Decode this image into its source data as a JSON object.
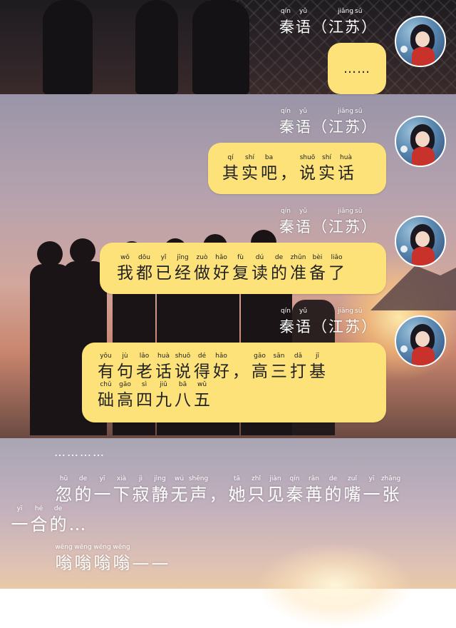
{
  "speaker_label": "秦语（江苏）",
  "speaker_pinyin": [
    "qín",
    "yǔ",
    "jiāng",
    "sū"
  ],
  "messages": [
    {
      "id": "m1",
      "text": "……",
      "lines": []
    },
    {
      "id": "m2",
      "lines": [
        [
          [
            "其",
            "qí"
          ],
          [
            "实",
            "shí"
          ],
          [
            "吧",
            "ba"
          ],
          [
            "，",
            ""
          ],
          [
            "说",
            "shuō"
          ],
          [
            "实",
            "shí"
          ],
          [
            "话",
            "huà"
          ]
        ]
      ]
    },
    {
      "id": "m3",
      "lines": [
        [
          [
            "我",
            "wǒ"
          ],
          [
            "都",
            "dōu"
          ],
          [
            "已",
            "yǐ"
          ],
          [
            "经",
            "jīng"
          ],
          [
            "做",
            "zuò"
          ],
          [
            "好",
            "hǎo"
          ],
          [
            "复",
            "fù"
          ],
          [
            "读",
            "dú"
          ],
          [
            "的",
            "de"
          ],
          [
            "准",
            "zhǔn"
          ],
          [
            "备",
            "bèi"
          ],
          [
            "了",
            "liǎo"
          ]
        ]
      ]
    },
    {
      "id": "m4",
      "lines": [
        [
          [
            "有",
            "yǒu"
          ],
          [
            "句",
            "jù"
          ],
          [
            "老",
            "lǎo"
          ],
          [
            "话",
            "huà"
          ],
          [
            "说",
            "shuō"
          ],
          [
            "得",
            "dé"
          ],
          [
            "好",
            "hǎo"
          ],
          [
            "，",
            ""
          ],
          [
            "高",
            "gāo"
          ],
          [
            "三",
            "sān"
          ],
          [
            "打",
            "dǎ"
          ],
          [
            "基",
            "jī"
          ]
        ],
        [
          [
            "础",
            "chǔ"
          ],
          [
            "高",
            "gāo"
          ],
          [
            "四",
            "sì"
          ],
          [
            "九",
            "jiǔ"
          ],
          [
            "八",
            "bā"
          ],
          [
            "五",
            "wǔ"
          ]
        ]
      ]
    }
  ],
  "narration": {
    "dots": "…………",
    "line1": [
      [
        "忽",
        "hū"
      ],
      [
        "的",
        "de"
      ],
      [
        "一",
        "yī"
      ],
      [
        "下",
        "xià"
      ],
      [
        "寂",
        "jì"
      ],
      [
        "静",
        "jìng"
      ],
      [
        "无",
        "wú"
      ],
      [
        "声",
        "shēng"
      ],
      [
        "，",
        ""
      ],
      [
        "她",
        "tā"
      ],
      [
        "只",
        "zhǐ"
      ],
      [
        "见",
        "jiàn"
      ],
      [
        "秦",
        "qín"
      ],
      [
        "苒",
        "rǎn"
      ],
      [
        "的",
        "de"
      ],
      [
        "嘴",
        "zuǐ"
      ],
      [
        "一",
        "yī"
      ],
      [
        "张",
        "zhāng"
      ]
    ],
    "line2": [
      [
        "一",
        "yī"
      ],
      [
        "合",
        "hé"
      ],
      [
        "的",
        "de"
      ],
      [
        "…",
        ""
      ]
    ],
    "line3": [
      [
        "嗡",
        "wēng"
      ],
      [
        "嗡",
        "wēng"
      ],
      [
        "嗡",
        "wēng"
      ],
      [
        "嗡",
        "wēng"
      ],
      [
        "—",
        ""
      ],
      [
        "—",
        ""
      ]
    ]
  }
}
